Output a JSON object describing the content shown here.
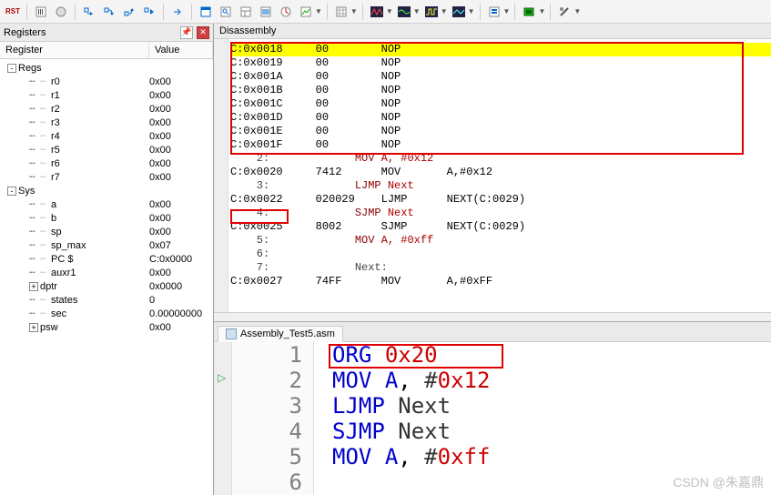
{
  "toolbar": {
    "rst_label": "RST",
    "icons": [
      "reset",
      "stop",
      "void",
      "step-into",
      "step-over",
      "step-out",
      "run-to",
      "sep",
      "run",
      "sep",
      "window",
      "find",
      "layout",
      "breakpoints",
      "perf",
      "analyze",
      "sep",
      "grid",
      "sep",
      "wave-1",
      "wave-2",
      "wave-3",
      "wave-4",
      "sep",
      "stack",
      "sep",
      "chip",
      "sep",
      "tools"
    ]
  },
  "panes": {
    "registers_title": "Registers",
    "disassembly_title": "Disassembly"
  },
  "reg_columns": {
    "c1": "Register",
    "c2": "Value"
  },
  "regs_group": "Regs",
  "sys_group": "Sys",
  "regs": [
    {
      "n": "r0",
      "v": "0x00"
    },
    {
      "n": "r1",
      "v": "0x00"
    },
    {
      "n": "r2",
      "v": "0x00"
    },
    {
      "n": "r3",
      "v": "0x00"
    },
    {
      "n": "r4",
      "v": "0x00"
    },
    {
      "n": "r5",
      "v": "0x00"
    },
    {
      "n": "r6",
      "v": "0x00"
    },
    {
      "n": "r7",
      "v": "0x00"
    }
  ],
  "sys": [
    {
      "n": "a",
      "v": "0x00"
    },
    {
      "n": "b",
      "v": "0x00"
    },
    {
      "n": "sp",
      "v": "0x00"
    },
    {
      "n": "sp_max",
      "v": "0x07"
    },
    {
      "n": "PC  $",
      "v": "C:0x0000"
    },
    {
      "n": "auxr1",
      "v": "0x00"
    },
    {
      "n": "dptr",
      "v": "0x0000",
      "exp": "+"
    },
    {
      "n": "states",
      "v": "0"
    },
    {
      "n": "sec",
      "v": "0.00000000"
    },
    {
      "n": "psw",
      "v": "0x00",
      "exp": "+"
    }
  ],
  "dis": [
    {
      "type": "asm",
      "hl": true,
      "addr": "C:0x0018",
      "bytes": "00",
      "mn": "NOP"
    },
    {
      "type": "asm",
      "addr": "C:0x0019",
      "bytes": "00",
      "mn": "NOP"
    },
    {
      "type": "asm",
      "addr": "C:0x001A",
      "bytes": "00",
      "mn": "NOP"
    },
    {
      "type": "asm",
      "addr": "C:0x001B",
      "bytes": "00",
      "mn": "NOP"
    },
    {
      "type": "asm",
      "addr": "C:0x001C",
      "bytes": "00",
      "mn": "NOP"
    },
    {
      "type": "asm",
      "addr": "C:0x001D",
      "bytes": "00",
      "mn": "NOP"
    },
    {
      "type": "asm",
      "addr": "C:0x001E",
      "bytes": "00",
      "mn": "NOP"
    },
    {
      "type": "asm",
      "addr": "C:0x001F",
      "bytes": "00",
      "mn": "NOP"
    },
    {
      "type": "src",
      "ln": "2",
      "txt": "MOV A, #0x12"
    },
    {
      "type": "asm",
      "addr": "C:0x0020",
      "bytes": "7412",
      "mn": "MOV",
      "ops": "A,#0x12"
    },
    {
      "type": "src",
      "ln": "3",
      "txt": "LJMP Next"
    },
    {
      "type": "asm",
      "addr": "C:0x0022",
      "bytes": "020029",
      "mn": "LJMP",
      "ops": "NEXT(C:0029)"
    },
    {
      "type": "src",
      "ln": "4",
      "txt": "SJMP Next"
    },
    {
      "type": "asm",
      "addr": "C:0x0025",
      "bytes": "8002",
      "mn": "SJMP",
      "ops": "NEXT(C:0029)"
    },
    {
      "type": "src",
      "ln": "5",
      "txt": "MOV A, #0xff"
    },
    {
      "type": "src",
      "ln": "6",
      "txt": ""
    },
    {
      "type": "src",
      "ln": "7",
      "txt": "Next:",
      "lbl": true
    },
    {
      "type": "asm",
      "addr": "C:0x0027",
      "bytes": "74FF",
      "mn": "MOV",
      "ops": "A,#0xFF",
      "cut": true
    }
  ],
  "src_tab": "Assembly_Test5.asm",
  "src_lines": [
    {
      "ln": "1",
      "parts": [
        {
          "t": "ORG",
          "c": "kw"
        },
        {
          "t": " ",
          "c": ""
        },
        {
          "t": "0x20",
          "c": "num"
        }
      ]
    },
    {
      "ln": "2",
      "parts": [
        {
          "t": "MOV",
          "c": "kw"
        },
        {
          "t": " ",
          "c": ""
        },
        {
          "t": "A",
          "c": "reg"
        },
        {
          "t": ", ",
          "c": ""
        },
        {
          "t": "#",
          "c": "id"
        },
        {
          "t": "0x12",
          "c": "num"
        }
      ]
    },
    {
      "ln": "3",
      "parts": [
        {
          "t": "LJMP",
          "c": "kw"
        },
        {
          "t": " Next",
          "c": "id"
        }
      ]
    },
    {
      "ln": "4",
      "parts": [
        {
          "t": "SJMP",
          "c": "kw"
        },
        {
          "t": " Next",
          "c": "id"
        }
      ]
    },
    {
      "ln": "5",
      "parts": [
        {
          "t": "MOV",
          "c": "kw"
        },
        {
          "t": " ",
          "c": ""
        },
        {
          "t": "A",
          "c": "reg"
        },
        {
          "t": ", ",
          "c": ""
        },
        {
          "t": "#",
          "c": "id"
        },
        {
          "t": "0xff",
          "c": "num"
        }
      ]
    },
    {
      "ln": "6",
      "parts": []
    }
  ],
  "watermark": "CSDN @朱嘉鼎"
}
